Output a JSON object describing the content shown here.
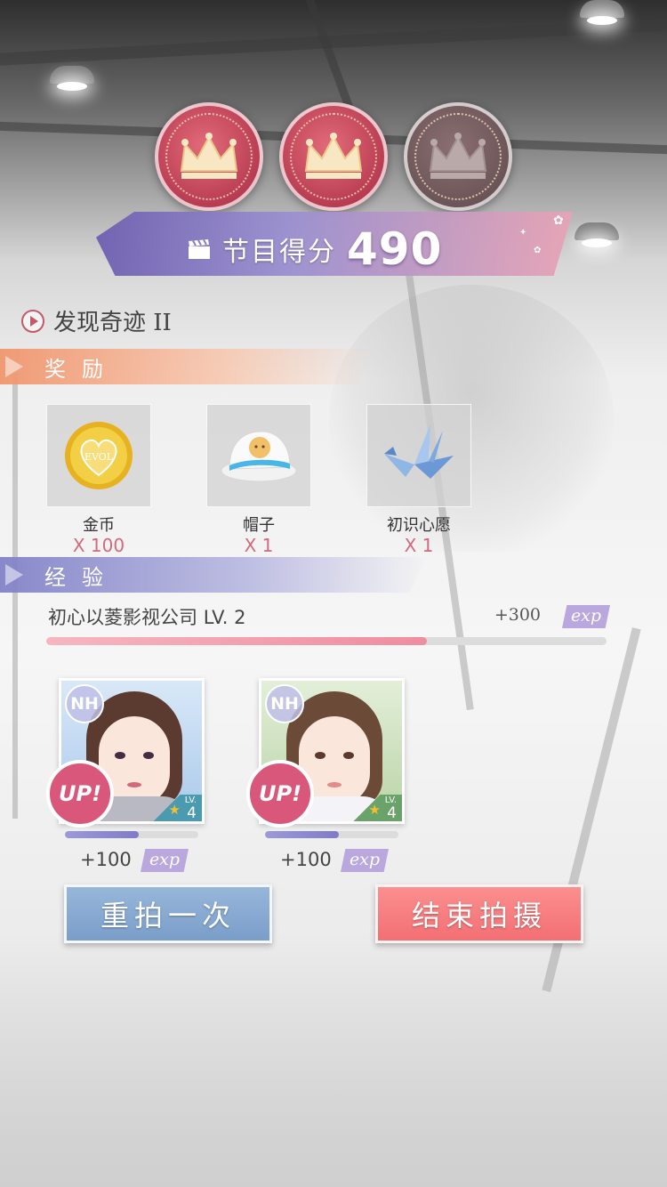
{
  "crowns": {
    "earned": 2,
    "total": 3
  },
  "score": {
    "label": "节目得分",
    "value": "490"
  },
  "stage": {
    "title": "发现奇迹 II"
  },
  "sections": {
    "reward": "奖励",
    "exp": "经验"
  },
  "rewards": [
    {
      "name": "金币",
      "qty": "X 100",
      "icon": "gold-coin-icon",
      "coin_text": "EVOL"
    },
    {
      "name": "帽子",
      "qty": "X 1",
      "icon": "hat-icon"
    },
    {
      "name": "初识心愿",
      "qty": "X 1",
      "icon": "paper-crane-icon"
    }
  ],
  "company": {
    "name": "初心以菱影视公司",
    "level": "LV. 2",
    "gain": "+300",
    "exp_label": "exp",
    "progress": 0.68
  },
  "characters": [
    {
      "badge": "NH",
      "up": "UP!",
      "lv_label": "LV.",
      "level": "4",
      "progress": 0.55,
      "gain": "+100",
      "exp_label": "exp"
    },
    {
      "badge": "NH",
      "up": "UP!",
      "lv_label": "LV.",
      "level": "4",
      "progress": 0.55,
      "gain": "+100",
      "exp_label": "exp"
    }
  ],
  "buttons": {
    "retry": "重拍一次",
    "finish": "结束拍摄"
  },
  "colors": {
    "accent_pink": "#f36f73",
    "accent_blue": "#7a9ec9",
    "crown_on": "#b93d52",
    "crown_off": "#6c5558"
  }
}
